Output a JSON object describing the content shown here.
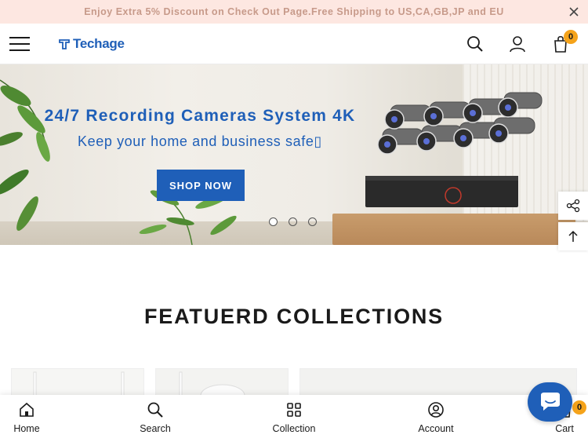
{
  "announcement": {
    "text": "Enjoy Extra 5% Discount on Check Out Page.Free Shipping to US,CA,GB,JP and EU"
  },
  "header": {
    "logo_text": "Techage",
    "cart_count": "0"
  },
  "hero": {
    "title": "24/7 Recording Cameras System 4K",
    "subtitle": "Keep your home and business safe",
    "subtitle_glyph": "▯",
    "button_label": "SHOP NOW",
    "slides": 3,
    "active_slide": 1
  },
  "featured": {
    "title": "FEATUERD COLLECTIONS"
  },
  "bottom_nav": {
    "items": [
      {
        "label": "Home",
        "icon": "home-icon"
      },
      {
        "label": "Search",
        "icon": "search-icon"
      },
      {
        "label": "Collection",
        "icon": "grid-icon"
      },
      {
        "label": "Account",
        "icon": "account-icon"
      },
      {
        "label": "Cart",
        "icon": "cart-icon",
        "badge": "0"
      }
    ]
  },
  "colors": {
    "brand_blue": "#1f5fb8",
    "announce_bg": "#fde7e1",
    "badge": "#f5a31a"
  }
}
